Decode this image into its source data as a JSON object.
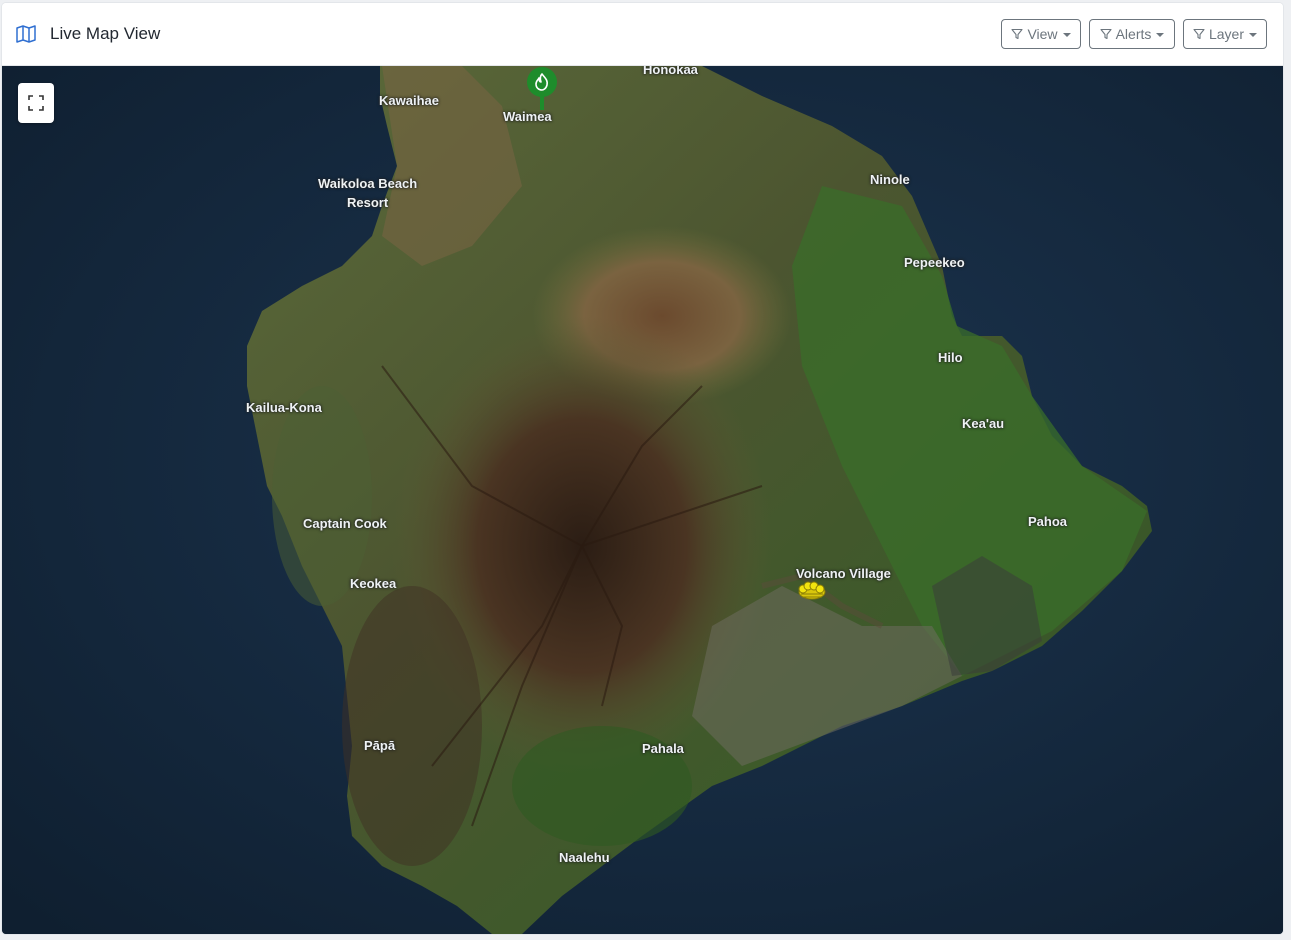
{
  "header": {
    "title": "Live Map View",
    "title_icon": "map-icon",
    "buttons": [
      {
        "label": "View",
        "icon": "filter-icon"
      },
      {
        "label": "Alerts",
        "icon": "filter-icon"
      },
      {
        "label": "Layer",
        "icon": "filter-icon"
      }
    ]
  },
  "map": {
    "layer": "satellite",
    "fullscreen_icon": "fullscreen-icon",
    "places": [
      {
        "name": "Honokaa"
      },
      {
        "name": "Kawaihae"
      },
      {
        "name": "Waimea"
      },
      {
        "name": "Waikoloa Beach\nResort"
      },
      {
        "name": "Ninole"
      },
      {
        "name": "Pepeekeo"
      },
      {
        "name": "Hilo"
      },
      {
        "name": "Kailua-Kona"
      },
      {
        "name": "Kea'au"
      },
      {
        "name": "Captain Cook"
      },
      {
        "name": "Pahoa"
      },
      {
        "name": "Volcano Village"
      },
      {
        "name": "Keokea"
      },
      {
        "name": "Pāpā"
      },
      {
        "name": "Pahala"
      },
      {
        "name": "Naalehu"
      }
    ],
    "markers": [
      {
        "type": "fire-marker",
        "color": "#1e8c2b",
        "icon": "fire-icon"
      },
      {
        "type": "alert-cluster",
        "color": "#f2e30f"
      }
    ]
  },
  "colors": {
    "accent": "#0d6efd",
    "ocean": "#15283a",
    "btn_outline": "#6c757d"
  }
}
